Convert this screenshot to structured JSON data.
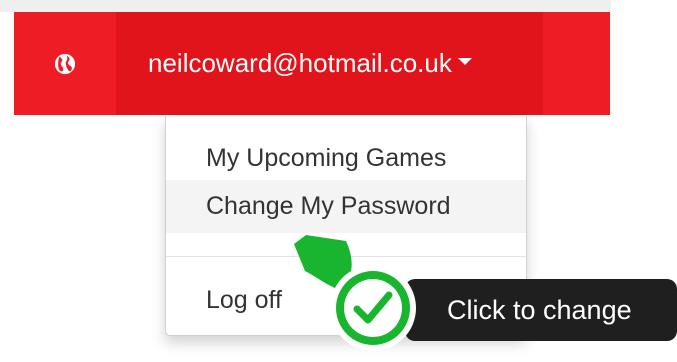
{
  "navbar": {
    "globe_icon": "globe-icon",
    "account_email": "neilcoward@hotmail.co.uk",
    "caret_icon": "caret-down-icon",
    "brand_color": "#ee1c25",
    "active_color": "#e1141c"
  },
  "dropdown": {
    "items": [
      {
        "label": "My Upcoming Games"
      },
      {
        "label": "Change My Password",
        "highlighted": true
      },
      {
        "label": "Log off"
      }
    ]
  },
  "callout": {
    "icon": "check-icon",
    "text": "Click to change",
    "accent_color": "#1ab52e"
  }
}
